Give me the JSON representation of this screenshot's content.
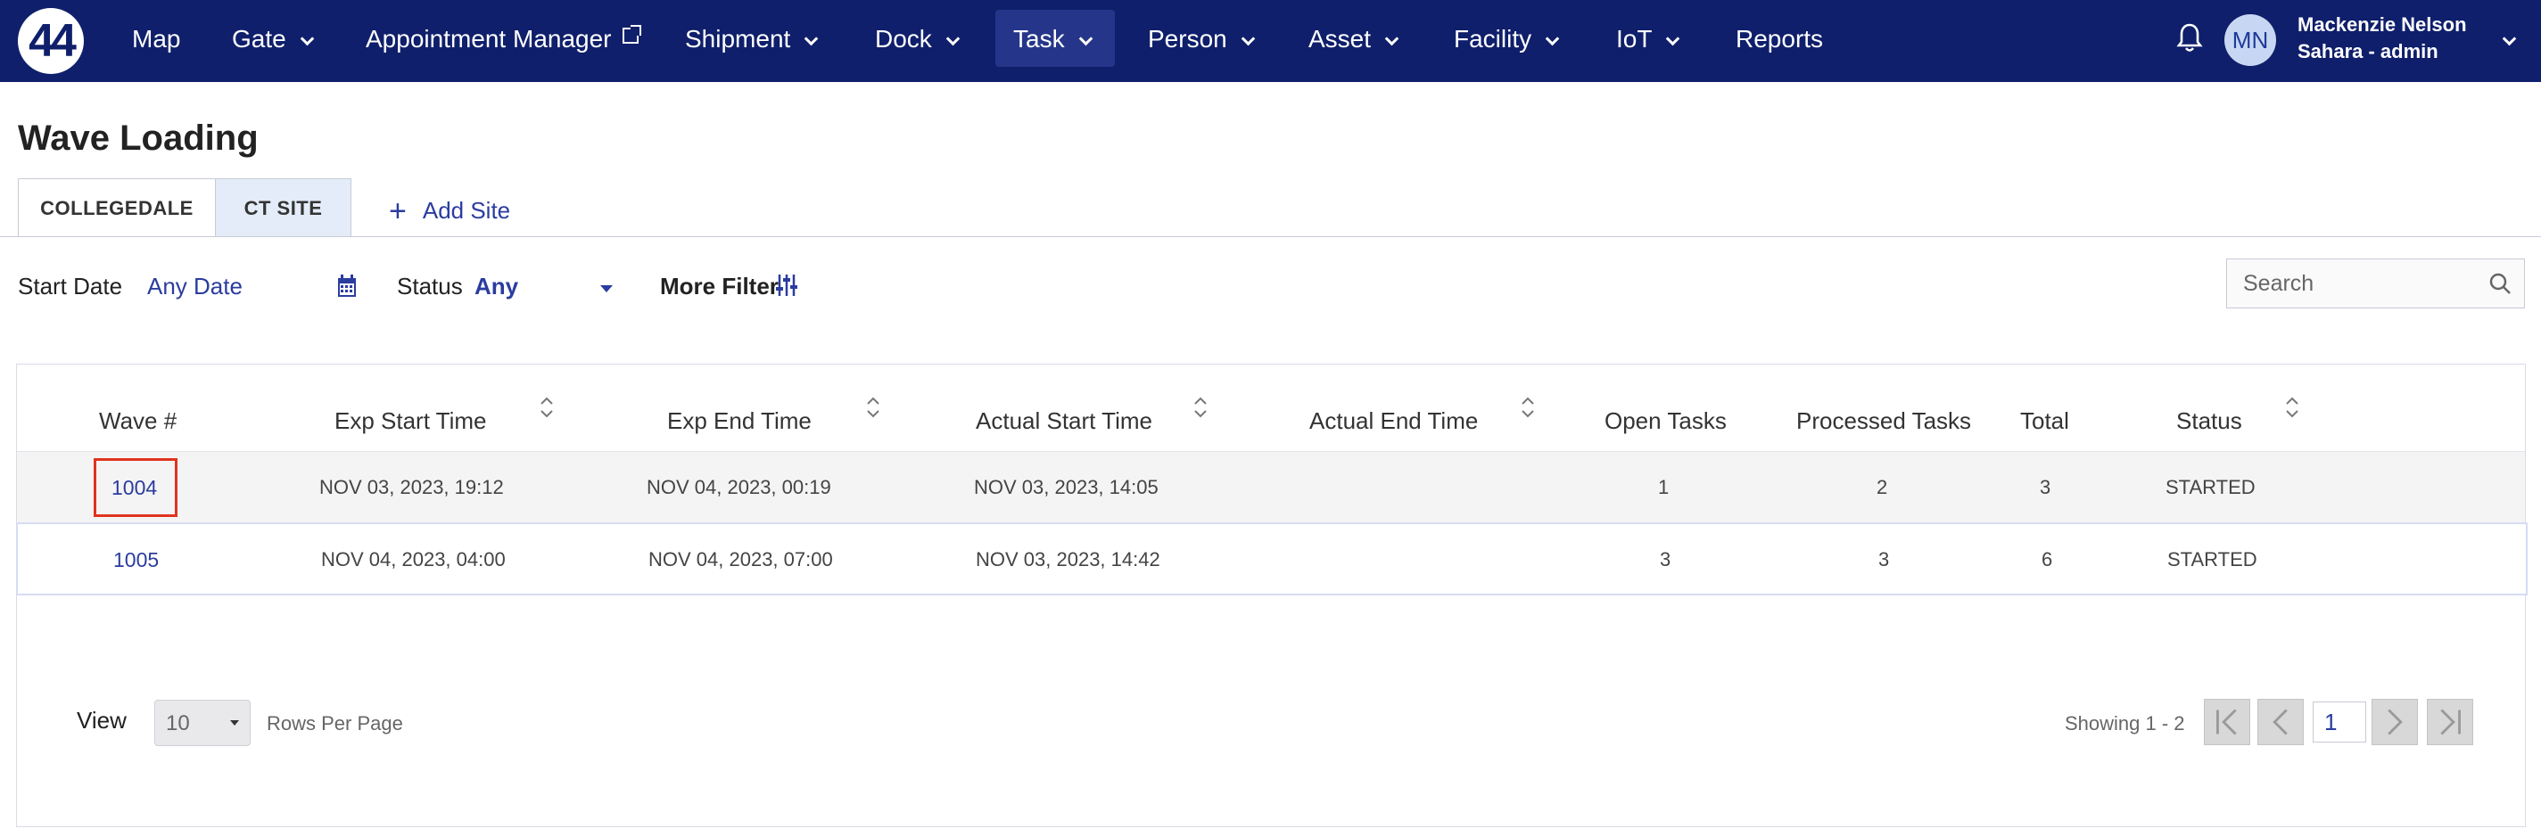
{
  "nav": {
    "logo": "44",
    "items": [
      {
        "label": "Map"
      },
      {
        "label": "Gate"
      },
      {
        "label": "Appointment Manager"
      },
      {
        "label": "Shipment"
      },
      {
        "label": "Dock"
      },
      {
        "label": "Task"
      },
      {
        "label": "Person"
      },
      {
        "label": "Asset"
      },
      {
        "label": "Facility"
      },
      {
        "label": "IoT"
      },
      {
        "label": "Reports"
      }
    ],
    "active": "Task",
    "user": {
      "initials": "MN",
      "name": "Mackenzie Nelson",
      "role": "Sahara - admin"
    }
  },
  "page": {
    "title": "Wave Loading",
    "tabs": [
      {
        "label": "COLLEGEDALE"
      },
      {
        "label": "CT SITE"
      }
    ],
    "add_site": "Add Site"
  },
  "filters": {
    "start_date_label": "Start Date",
    "start_date_value": "Any Date",
    "status_label": "Status",
    "status_value": "Any",
    "more_filter": "More Filter",
    "search_placeholder": "Search"
  },
  "table": {
    "columns": [
      "Wave #",
      "Exp Start Time",
      "Exp End Time",
      "Actual Start Time",
      "Actual End Time",
      "Open Tasks",
      "Processed Tasks",
      "Total",
      "Status"
    ],
    "rows": [
      {
        "wave": "1004",
        "exp_start": "NOV 03, 2023, 19:12",
        "exp_end": "NOV 04, 2023, 00:19",
        "actual_start": "NOV 03, 2023, 14:05",
        "actual_end": "",
        "open": "1",
        "processed": "2",
        "total": "3",
        "status": "STARTED"
      },
      {
        "wave": "1005",
        "exp_start": "NOV 04, 2023, 04:00",
        "exp_end": "NOV 04, 2023, 07:00",
        "actual_start": "NOV 03, 2023, 14:42",
        "actual_end": "",
        "open": "3",
        "processed": "3",
        "total": "6",
        "status": "STARTED"
      }
    ]
  },
  "pagination": {
    "view_label": "View",
    "rows_per_page": "10",
    "rows_per_page_label": "Rows Per Page",
    "showing": "Showing 1 - 2",
    "current_page": "1"
  },
  "colors": {
    "nav_bg": "#0f1f6b",
    "accent": "#2b3c9f",
    "highlight": "#e0331e"
  }
}
